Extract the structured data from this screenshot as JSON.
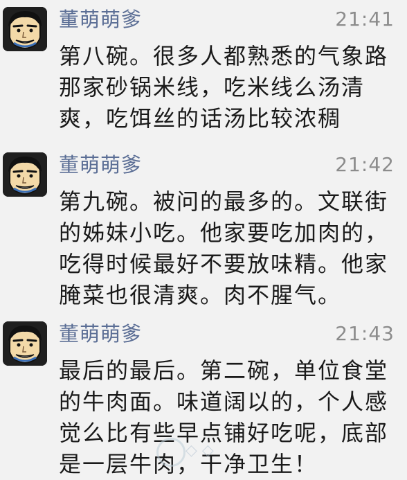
{
  "posts": [
    {
      "user": "董萌萌爹",
      "time": "21:41",
      "text": "第八碗。很多人都熟悉的气象路\n那家砂锅米线，吃米线么汤清\n爽，吃饵丝的话汤比较浓稠",
      "avatar_icon": "cartoon-face-icon"
    },
    {
      "user": "董萌萌爹",
      "time": "21:42",
      "text": "第九碗。被问的最多的。文联街\n的姊妹小吃。他家要吃加肉的，\n吃得时候最好不要放味精。他家\n腌菜也很清爽。肉不腥气。",
      "avatar_icon": "cartoon-face-icon"
    },
    {
      "user": "董萌萌爹",
      "time": "21:43",
      "text": "最后的最后。第二碗，单位食堂\n的牛肉面。味道阔以的，个人感\n觉么比有些早点铺好吃呢，底部\n是一层牛肉，干净卫生！",
      "avatar_icon": "cartoon-face-icon"
    }
  ],
  "colors": {
    "background": "#f2f2f2",
    "username": "#5b6e95",
    "time": "#8c8c8c",
    "text": "#1a1a1a"
  }
}
